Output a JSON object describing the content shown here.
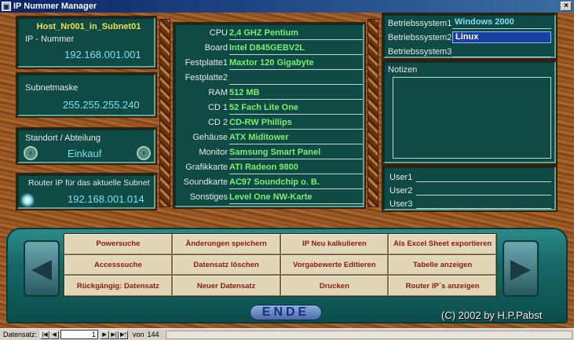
{
  "window": {
    "title": "IP Nummer Manager",
    "close_label": "×"
  },
  "host": {
    "name": "Host_Nr001_in_Subnet01",
    "ip_label": "IP - Nummer",
    "ip": "192.168.001.001"
  },
  "subnet": {
    "label": "Subnetmaske",
    "value": "255.255.255.240"
  },
  "location": {
    "label": "Standort / Abteilung",
    "value": "Einkauf",
    "prev": "‹",
    "next": "›"
  },
  "router": {
    "label": "Router IP für das aktuelle Subnet",
    "value": "192.168.001.014"
  },
  "hardware": [
    {
      "label": "CPU",
      "value": "2,4 GHZ Pentium"
    },
    {
      "label": "Board",
      "value": "Intel D845GEBV2L"
    },
    {
      "label": "Festplatte1",
      "value": "Maxtor 120 Gigabyte"
    },
    {
      "label": "Festplatte2",
      "value": ""
    },
    {
      "label": "RAM",
      "value": "512 MB"
    },
    {
      "label": "CD 1",
      "value": "52 Fach Lite One"
    },
    {
      "label": "CD 2",
      "value": "CD-RW Phillips"
    },
    {
      "label": "Gehäuse",
      "value": "ATX Miditower"
    },
    {
      "label": "Monitor",
      "value": "Samsung Smart Panel"
    },
    {
      "label": "Grafikkarte",
      "value": "ATI Radeon 9800"
    },
    {
      "label": "Soundkarte",
      "value": "AC97 Soundchip o. B."
    },
    {
      "label": "Sonstiges",
      "value": "Level One NW-Karte"
    }
  ],
  "os": [
    {
      "label": "Betriebssystem1",
      "value": "Windows 2000"
    },
    {
      "label": "Betriebssystem2",
      "value": "Linux"
    },
    {
      "label": "Betriebssystem3",
      "value": ""
    }
  ],
  "notes": {
    "label": "Notizen"
  },
  "users": [
    {
      "label": "User1"
    },
    {
      "label": "User2"
    },
    {
      "label": "User3"
    }
  ],
  "buttons": [
    "Powersuche",
    "Änderungen speichern",
    "IP Neu kalkulieren",
    "Als Excel Sheet exportieren",
    "Accesssuche",
    "Datensatz löschen",
    "Vorgabewerte Editieren",
    "Tabelle anzeigen",
    "Rückgängig: Datensatz",
    "Neuer Datensatz",
    "Drucken",
    "Router IP´s anzeigen"
  ],
  "ende_label": "ENDE",
  "copyright": "(C) 2002 by H.P.Pabst",
  "statusbar": {
    "label": "Datensatz:",
    "current": "1",
    "of_label": "von",
    "total": "144"
  }
}
